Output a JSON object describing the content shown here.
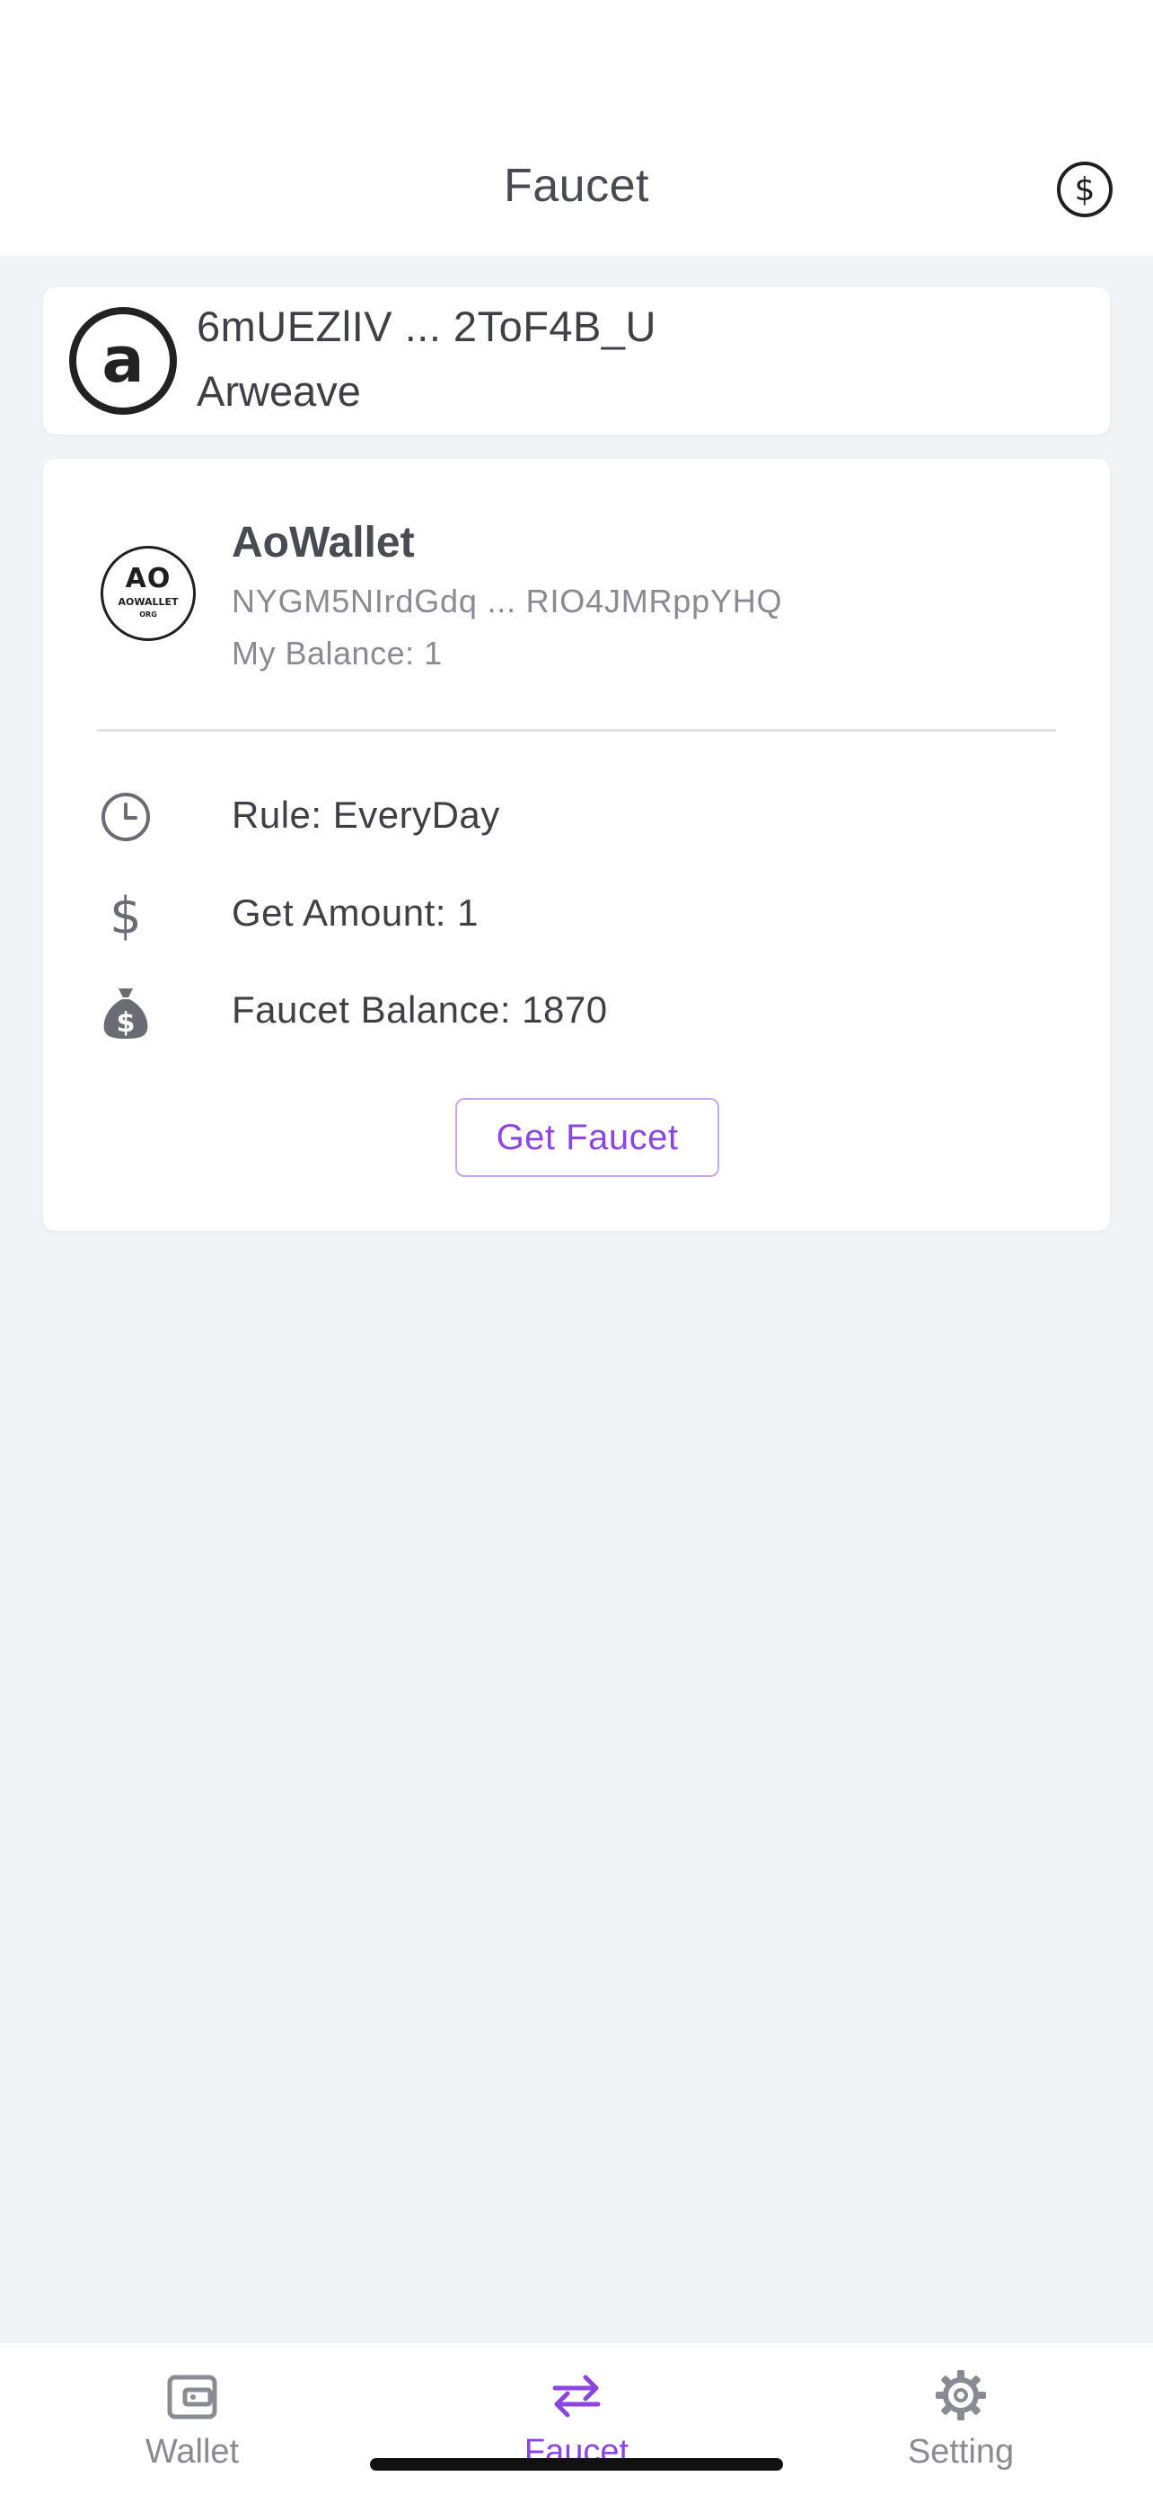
{
  "header": {
    "title": "Faucet",
    "action_icon": "dollar-circle-icon"
  },
  "account": {
    "logo_icon": "arweave-logo-icon",
    "address": "6mUEZlIV ... 2ToF4B_U",
    "network": "Arweave"
  },
  "token": {
    "logo_text": "AO",
    "logo_subtext": "AOWALLET",
    "logo_tinytext": "ORG",
    "name": "AoWallet",
    "address": "NYGM5NIrdGdq ... RIO4JMRppYHQ",
    "balance_text": "My Balance: 1"
  },
  "faucet_info": {
    "rule": {
      "icon": "clock-icon",
      "text": "Rule: EveryDay"
    },
    "amount": {
      "icon": "dollar-icon",
      "text": "Get Amount: 1"
    },
    "balance": {
      "icon": "money-bag-icon",
      "text": "Faucet Balance: 1870"
    }
  },
  "actions": {
    "get_faucet_label": "Get Faucet"
  },
  "tabbar": {
    "items": [
      {
        "label": "Wallet",
        "icon": "wallet-icon",
        "active": false
      },
      {
        "label": "Faucet",
        "icon": "swap-arrows-icon",
        "active": true
      },
      {
        "label": "Setting",
        "icon": "gear-icon",
        "active": false
      }
    ]
  },
  "colors": {
    "accent": "#8b46e0",
    "background": "#f2f3f7",
    "card": "#ffffff",
    "text": "#3f3f46",
    "muted": "#8a8a93"
  }
}
